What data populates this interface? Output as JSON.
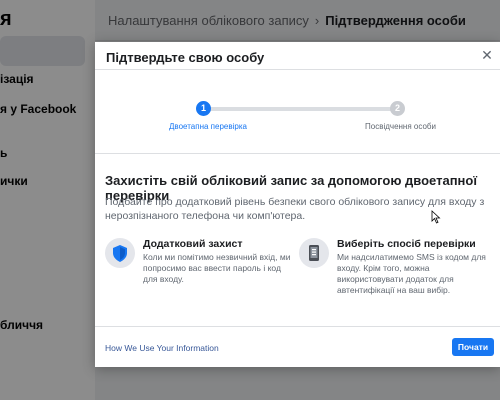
{
  "sidebar": {
    "heading": "я",
    "items": [
      {
        "label": "ізація"
      },
      {
        "label": "я у Facebook"
      },
      {
        "label": "ь"
      },
      {
        "label": "ички"
      },
      {
        "label": "бличчя"
      }
    ]
  },
  "breadcrumb": {
    "parent": "Налаштування облікового запису",
    "separator": "›",
    "current": "Підтвердження особи"
  },
  "modal": {
    "title": "Підтвердьте свою особу",
    "close_icon": "close-icon",
    "steps": [
      {
        "number": "1",
        "label": "Двоетапна перевірка",
        "active": true
      },
      {
        "number": "2",
        "label": "Посвідчення особи",
        "active": false
      }
    ],
    "heading": "Захистіть свій обліковий запис за допомогою двоетапної перевірки",
    "description": "Подбайте про додатковий рівень безпеки свого облікового запису для входу з нерозпізнаного телефона чи комп'ютера.",
    "features": [
      {
        "icon": "shield-icon",
        "title": "Додатковий захист",
        "text": "Коли ми помітимо незвичний вхід, ми попросимо вас ввести пароль і код для входу."
      },
      {
        "icon": "phone-icon",
        "title": "Виберіть спосіб перевірки",
        "text": "Ми надсилатимемо SMS із кодом для входу. Крім того, можна використовувати додаток для автентифікації на ваш вибір."
      }
    ],
    "footer_link": "How We Use Your Information",
    "primary_button": "Почати"
  },
  "colors": {
    "accent": "#1877f2",
    "overlay": "rgba(0,0,0,0.45)",
    "link": "#385898"
  }
}
